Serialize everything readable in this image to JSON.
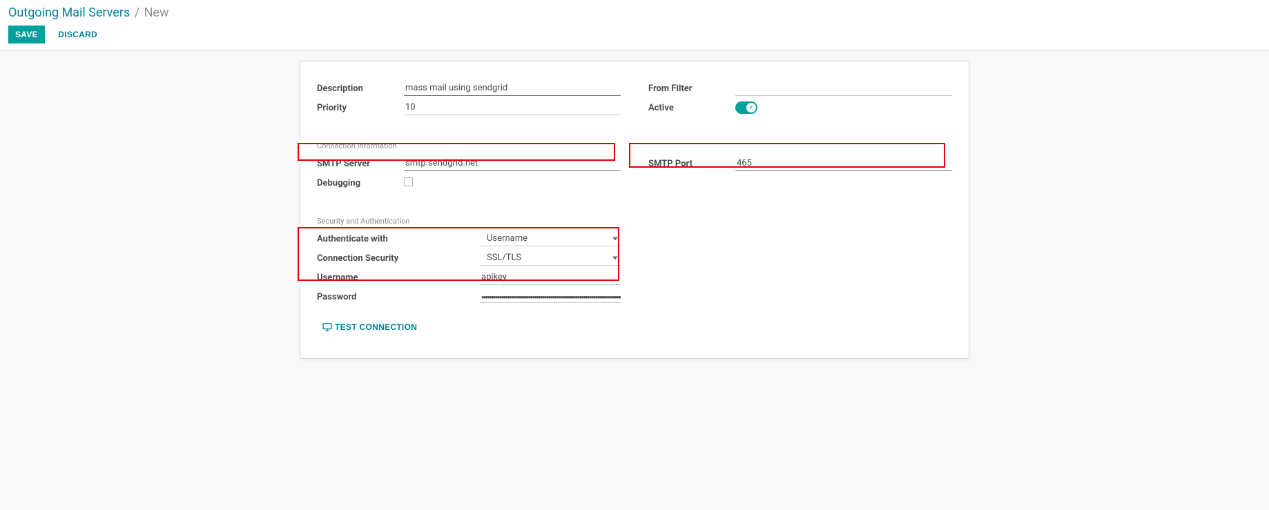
{
  "breadcrumb": {
    "parent": "Outgoing Mail Servers",
    "current": "New"
  },
  "actions": {
    "save": "SAVE",
    "discard": "DISCARD"
  },
  "form": {
    "description_label": "Description",
    "description_value": "mass mail using sendgrid",
    "priority_label": "Priority",
    "priority_value": "10",
    "from_filter_label": "From Filter",
    "from_filter_value": "",
    "active_label": "Active",
    "active_on": true
  },
  "sections": {
    "conn_info": "Connection Information",
    "sec_auth": "Security and Authentication"
  },
  "conn": {
    "smtp_server_label": "SMTP Server",
    "smtp_server_value": "smtp.sendgrid.net",
    "smtp_port_label": "SMTP Port",
    "smtp_port_value": "465",
    "debugging_label": "Debugging"
  },
  "auth": {
    "auth_with_label": "Authenticate with",
    "auth_with_value": "Username",
    "conn_sec_label": "Connection Security",
    "conn_sec_value": "SSL/TLS",
    "username_label": "Username",
    "username_value": "apikey",
    "password_label": "Password",
    "password_value": "●●●●●●●●●●●●●●●●●●●●●●●●●●●●●●●●●●●●●●●●●●●●●●●●●●●●●●●●●●●●●●●●●●●●●●●●"
  },
  "test_connection": "TEST CONNECTION"
}
